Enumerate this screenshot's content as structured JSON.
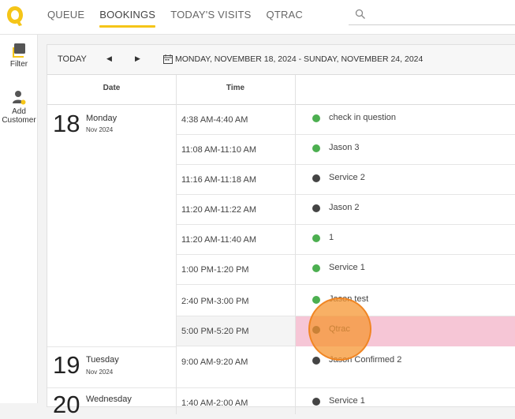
{
  "header": {
    "tabs": [
      {
        "label": "QUEUE",
        "active": false
      },
      {
        "label": "BOOKINGS",
        "active": true
      },
      {
        "label": "TODAY'S VISITS",
        "active": false
      },
      {
        "label": "QTRAC",
        "active": false
      }
    ],
    "search": {
      "value": "",
      "placeholder": ""
    }
  },
  "sidebar": {
    "filter_label": "Filter",
    "add_customer_label_1": "Add",
    "add_customer_label_2": "Customer"
  },
  "toolbar": {
    "today_label": "TODAY",
    "prev_icon": "◀",
    "next_icon": "▶",
    "date_range": "MONDAY, NOVEMBER 18, 2024 - SUNDAY, NOVEMBER 24, 2024"
  },
  "table": {
    "columns": [
      "Date",
      "Time",
      ""
    ],
    "days": [
      {
        "num": "18",
        "name": "Monday",
        "sub": "Nov 2024"
      },
      {
        "num": "19",
        "name": "Tuesday",
        "sub": "Nov 2024"
      },
      {
        "num": "20",
        "name": "Wednesday",
        "sub": ""
      }
    ],
    "rows": [
      {
        "time": "4:38 AM-4:40 AM",
        "service": "check in question",
        "status": "green"
      },
      {
        "time": "11:08 AM-11:10 AM",
        "service": "Jason 3",
        "status": "green"
      },
      {
        "time": "11:16 AM-11:18 AM",
        "service": "Service 2",
        "status": "dark"
      },
      {
        "time": "11:20 AM-11:22 AM",
        "service": "Jason 2",
        "status": "dark"
      },
      {
        "time": "11:20 AM-11:40 AM",
        "service": "1",
        "status": "green"
      },
      {
        "time": "1:00 PM-1:20 PM",
        "service": "Service 1",
        "status": "green"
      },
      {
        "time": "2:40 PM-3:00 PM",
        "service": "Jason test",
        "status": "green"
      },
      {
        "time": "5:00 PM-5:20 PM",
        "service": "Qtrac",
        "status": "dark"
      },
      {
        "time": "9:00 AM-9:20 AM",
        "service": "Jason Confirmed 2",
        "status": "dark"
      },
      {
        "time": "1:40 AM-2:00 AM",
        "service": "Service 1",
        "status": "dark"
      }
    ]
  },
  "colors": {
    "accent": "#f5c518",
    "status_green": "#4caf50",
    "status_dark": "#444444",
    "highlight": "#f6c6d6",
    "click_indicator": "#f59632"
  },
  "icons": {
    "logo": "q-logo-icon",
    "search": "search-icon",
    "filter": "filter-icon",
    "add_customer": "add-person-icon",
    "calendar": "calendar-icon"
  }
}
